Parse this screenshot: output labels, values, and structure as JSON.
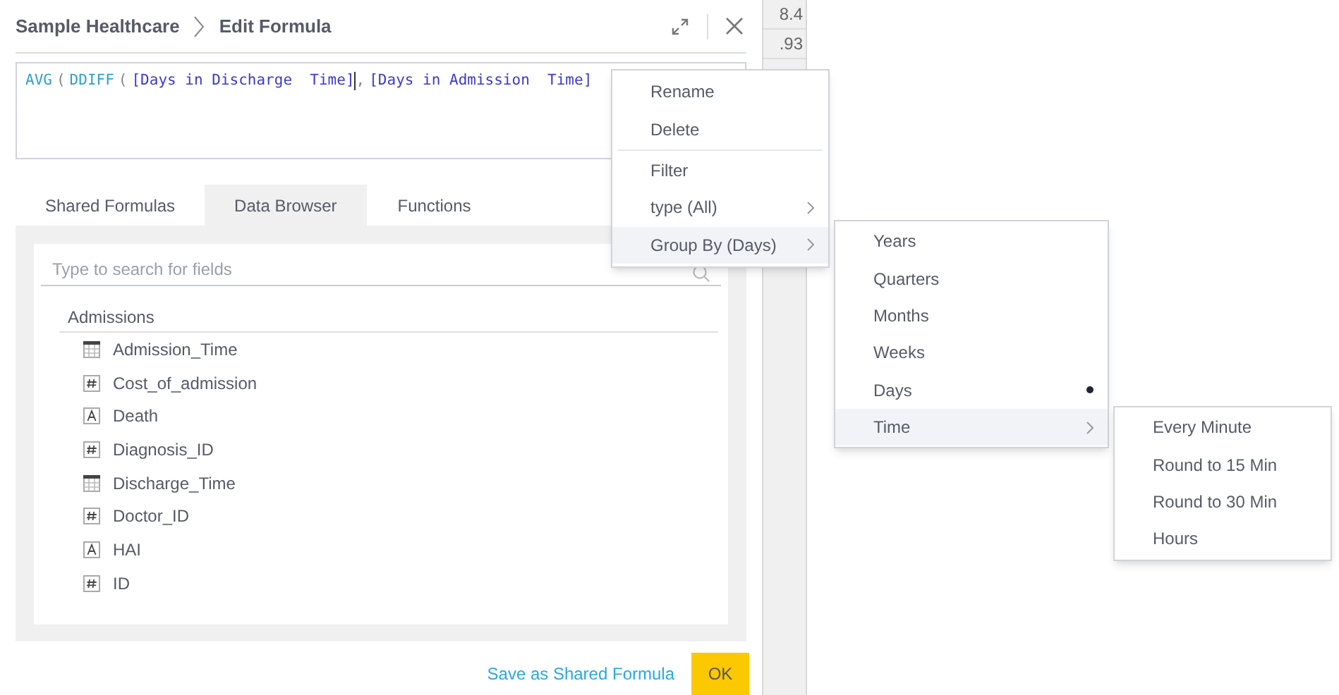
{
  "background_table": {
    "cells": [
      "8.4",
      ".93"
    ]
  },
  "dialog": {
    "breadcrumb": [
      "Sample Healthcare",
      "Edit Formula"
    ],
    "formula": [
      {
        "kind": "function",
        "text": "AVG"
      },
      {
        "kind": "paren",
        "text": "("
      },
      {
        "kind": "function",
        "text": "DDIFF"
      },
      {
        "kind": "paren",
        "text": "("
      },
      {
        "kind": "field",
        "text": "[Days in Discharge  Time]"
      },
      {
        "kind": "cursor"
      },
      {
        "kind": "paren",
        "text": ","
      },
      {
        "kind": "field",
        "text": "[Days in Admission  Time]"
      }
    ],
    "tabs": [
      {
        "label": "Shared Formulas",
        "selected": false
      },
      {
        "label": "Data Browser",
        "selected": true
      },
      {
        "label": "Functions",
        "selected": false
      }
    ],
    "search": {
      "placeholder": "Type to search for fields"
    },
    "group": "Admissions",
    "fields": [
      {
        "kind": "date",
        "name": "Admission_Time"
      },
      {
        "kind": "number",
        "name": "Cost_of_admission"
      },
      {
        "kind": "text",
        "name": "Death"
      },
      {
        "kind": "number",
        "name": "Diagnosis_ID"
      },
      {
        "kind": "date",
        "name": "Discharge_Time"
      },
      {
        "kind": "number",
        "name": "Doctor_ID"
      },
      {
        "kind": "text",
        "name": "HAI"
      },
      {
        "kind": "number",
        "name": "ID"
      }
    ],
    "link": "Save as Shared Formula",
    "ok": "OK"
  },
  "context_menu": [
    {
      "label": "Rename",
      "submenu": false,
      "highlighted": false
    },
    {
      "label": "Delete",
      "submenu": false,
      "highlighted": false
    },
    {
      "kind": "divider"
    },
    {
      "label": "Filter",
      "submenu": false,
      "highlighted": false
    },
    {
      "label": "type (All)",
      "submenu": true,
      "highlighted": false
    },
    {
      "label": "Group By (Days)",
      "submenu": true,
      "highlighted": true
    }
  ],
  "group_by_menu": [
    {
      "label": "Years",
      "selected": false,
      "submenu": false,
      "highlighted": false
    },
    {
      "label": "Quarters",
      "selected": false,
      "submenu": false,
      "highlighted": false
    },
    {
      "label": "Months",
      "selected": false,
      "submenu": false,
      "highlighted": false
    },
    {
      "label": "Weeks",
      "selected": false,
      "submenu": false,
      "highlighted": false
    },
    {
      "label": "Days",
      "selected": true,
      "submenu": false,
      "highlighted": false
    },
    {
      "label": "Time",
      "selected": false,
      "submenu": true,
      "highlighted": true
    }
  ],
  "time_menu": [
    {
      "label": "Every Minute"
    },
    {
      "label": "Round to 15 Min"
    },
    {
      "label": "Round to 30 Min"
    },
    {
      "label": "Hours"
    }
  ]
}
